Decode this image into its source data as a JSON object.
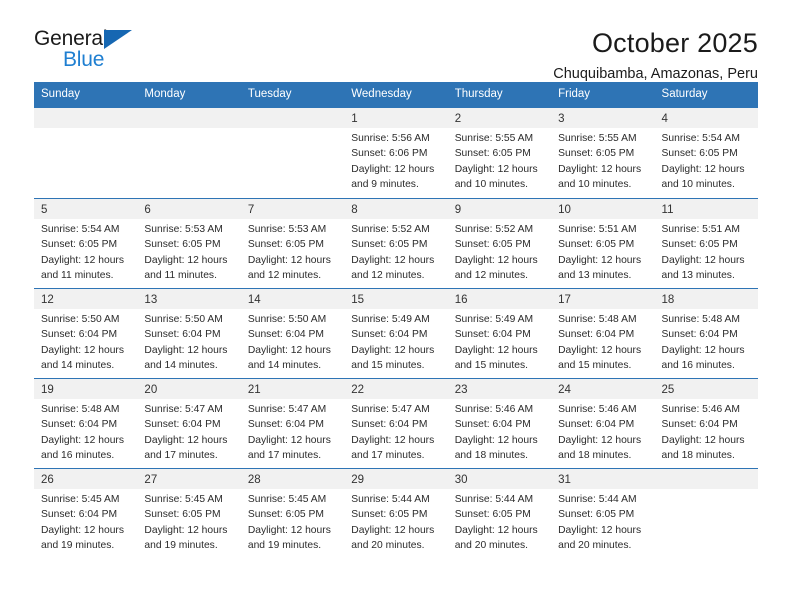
{
  "logo": {
    "word_top": "General",
    "word_bottom": "Blue",
    "triangle_color": "#1667b2",
    "blue_color": "#1f7fd1"
  },
  "header": {
    "title": "October 2025",
    "subtitle": "Chuquibamba, Amazonas, Peru"
  },
  "theme": {
    "header_blue": "#2e74b5",
    "daynum_gray": "#f1f1f1"
  },
  "weekdays": [
    "Sunday",
    "Monday",
    "Tuesday",
    "Wednesday",
    "Thursday",
    "Friday",
    "Saturday"
  ],
  "weeks": [
    [
      {
        "day": "",
        "empty": true,
        "sunrise": "",
        "sunset": "",
        "daylight_line1": "",
        "daylight_line2": ""
      },
      {
        "day": "",
        "empty": true,
        "sunrise": "",
        "sunset": "",
        "daylight_line1": "",
        "daylight_line2": ""
      },
      {
        "day": "",
        "empty": true,
        "sunrise": "",
        "sunset": "",
        "daylight_line1": "",
        "daylight_line2": ""
      },
      {
        "day": "1",
        "sunrise": "Sunrise: 5:56 AM",
        "sunset": "Sunset: 6:06 PM",
        "daylight_line1": "Daylight: 12 hours",
        "daylight_line2": "and 9 minutes."
      },
      {
        "day": "2",
        "sunrise": "Sunrise: 5:55 AM",
        "sunset": "Sunset: 6:05 PM",
        "daylight_line1": "Daylight: 12 hours",
        "daylight_line2": "and 10 minutes."
      },
      {
        "day": "3",
        "sunrise": "Sunrise: 5:55 AM",
        "sunset": "Sunset: 6:05 PM",
        "daylight_line1": "Daylight: 12 hours",
        "daylight_line2": "and 10 minutes."
      },
      {
        "day": "4",
        "sunrise": "Sunrise: 5:54 AM",
        "sunset": "Sunset: 6:05 PM",
        "daylight_line1": "Daylight: 12 hours",
        "daylight_line2": "and 10 minutes."
      }
    ],
    [
      {
        "day": "5",
        "sunrise": "Sunrise: 5:54 AM",
        "sunset": "Sunset: 6:05 PM",
        "daylight_line1": "Daylight: 12 hours",
        "daylight_line2": "and 11 minutes."
      },
      {
        "day": "6",
        "sunrise": "Sunrise: 5:53 AM",
        "sunset": "Sunset: 6:05 PM",
        "daylight_line1": "Daylight: 12 hours",
        "daylight_line2": "and 11 minutes."
      },
      {
        "day": "7",
        "sunrise": "Sunrise: 5:53 AM",
        "sunset": "Sunset: 6:05 PM",
        "daylight_line1": "Daylight: 12 hours",
        "daylight_line2": "and 12 minutes."
      },
      {
        "day": "8",
        "sunrise": "Sunrise: 5:52 AM",
        "sunset": "Sunset: 6:05 PM",
        "daylight_line1": "Daylight: 12 hours",
        "daylight_line2": "and 12 minutes."
      },
      {
        "day": "9",
        "sunrise": "Sunrise: 5:52 AM",
        "sunset": "Sunset: 6:05 PM",
        "daylight_line1": "Daylight: 12 hours",
        "daylight_line2": "and 12 minutes."
      },
      {
        "day": "10",
        "sunrise": "Sunrise: 5:51 AM",
        "sunset": "Sunset: 6:05 PM",
        "daylight_line1": "Daylight: 12 hours",
        "daylight_line2": "and 13 minutes."
      },
      {
        "day": "11",
        "sunrise": "Sunrise: 5:51 AM",
        "sunset": "Sunset: 6:05 PM",
        "daylight_line1": "Daylight: 12 hours",
        "daylight_line2": "and 13 minutes."
      }
    ],
    [
      {
        "day": "12",
        "sunrise": "Sunrise: 5:50 AM",
        "sunset": "Sunset: 6:04 PM",
        "daylight_line1": "Daylight: 12 hours",
        "daylight_line2": "and 14 minutes."
      },
      {
        "day": "13",
        "sunrise": "Sunrise: 5:50 AM",
        "sunset": "Sunset: 6:04 PM",
        "daylight_line1": "Daylight: 12 hours",
        "daylight_line2": "and 14 minutes."
      },
      {
        "day": "14",
        "sunrise": "Sunrise: 5:50 AM",
        "sunset": "Sunset: 6:04 PM",
        "daylight_line1": "Daylight: 12 hours",
        "daylight_line2": "and 14 minutes."
      },
      {
        "day": "15",
        "sunrise": "Sunrise: 5:49 AM",
        "sunset": "Sunset: 6:04 PM",
        "daylight_line1": "Daylight: 12 hours",
        "daylight_line2": "and 15 minutes."
      },
      {
        "day": "16",
        "sunrise": "Sunrise: 5:49 AM",
        "sunset": "Sunset: 6:04 PM",
        "daylight_line1": "Daylight: 12 hours",
        "daylight_line2": "and 15 minutes."
      },
      {
        "day": "17",
        "sunrise": "Sunrise: 5:48 AM",
        "sunset": "Sunset: 6:04 PM",
        "daylight_line1": "Daylight: 12 hours",
        "daylight_line2": "and 15 minutes."
      },
      {
        "day": "18",
        "sunrise": "Sunrise: 5:48 AM",
        "sunset": "Sunset: 6:04 PM",
        "daylight_line1": "Daylight: 12 hours",
        "daylight_line2": "and 16 minutes."
      }
    ],
    [
      {
        "day": "19",
        "sunrise": "Sunrise: 5:48 AM",
        "sunset": "Sunset: 6:04 PM",
        "daylight_line1": "Daylight: 12 hours",
        "daylight_line2": "and 16 minutes."
      },
      {
        "day": "20",
        "sunrise": "Sunrise: 5:47 AM",
        "sunset": "Sunset: 6:04 PM",
        "daylight_line1": "Daylight: 12 hours",
        "daylight_line2": "and 17 minutes."
      },
      {
        "day": "21",
        "sunrise": "Sunrise: 5:47 AM",
        "sunset": "Sunset: 6:04 PM",
        "daylight_line1": "Daylight: 12 hours",
        "daylight_line2": "and 17 minutes."
      },
      {
        "day": "22",
        "sunrise": "Sunrise: 5:47 AM",
        "sunset": "Sunset: 6:04 PM",
        "daylight_line1": "Daylight: 12 hours",
        "daylight_line2": "and 17 minutes."
      },
      {
        "day": "23",
        "sunrise": "Sunrise: 5:46 AM",
        "sunset": "Sunset: 6:04 PM",
        "daylight_line1": "Daylight: 12 hours",
        "daylight_line2": "and 18 minutes."
      },
      {
        "day": "24",
        "sunrise": "Sunrise: 5:46 AM",
        "sunset": "Sunset: 6:04 PM",
        "daylight_line1": "Daylight: 12 hours",
        "daylight_line2": "and 18 minutes."
      },
      {
        "day": "25",
        "sunrise": "Sunrise: 5:46 AM",
        "sunset": "Sunset: 6:04 PM",
        "daylight_line1": "Daylight: 12 hours",
        "daylight_line2": "and 18 minutes."
      }
    ],
    [
      {
        "day": "26",
        "sunrise": "Sunrise: 5:45 AM",
        "sunset": "Sunset: 6:04 PM",
        "daylight_line1": "Daylight: 12 hours",
        "daylight_line2": "and 19 minutes."
      },
      {
        "day": "27",
        "sunrise": "Sunrise: 5:45 AM",
        "sunset": "Sunset: 6:05 PM",
        "daylight_line1": "Daylight: 12 hours",
        "daylight_line2": "and 19 minutes."
      },
      {
        "day": "28",
        "sunrise": "Sunrise: 5:45 AM",
        "sunset": "Sunset: 6:05 PM",
        "daylight_line1": "Daylight: 12 hours",
        "daylight_line2": "and 19 minutes."
      },
      {
        "day": "29",
        "sunrise": "Sunrise: 5:44 AM",
        "sunset": "Sunset: 6:05 PM",
        "daylight_line1": "Daylight: 12 hours",
        "daylight_line2": "and 20 minutes."
      },
      {
        "day": "30",
        "sunrise": "Sunrise: 5:44 AM",
        "sunset": "Sunset: 6:05 PM",
        "daylight_line1": "Daylight: 12 hours",
        "daylight_line2": "and 20 minutes."
      },
      {
        "day": "31",
        "sunrise": "Sunrise: 5:44 AM",
        "sunset": "Sunset: 6:05 PM",
        "daylight_line1": "Daylight: 12 hours",
        "daylight_line2": "and 20 minutes."
      },
      {
        "day": "",
        "empty": true,
        "sunrise": "",
        "sunset": "",
        "daylight_line1": "",
        "daylight_line2": ""
      }
    ]
  ]
}
